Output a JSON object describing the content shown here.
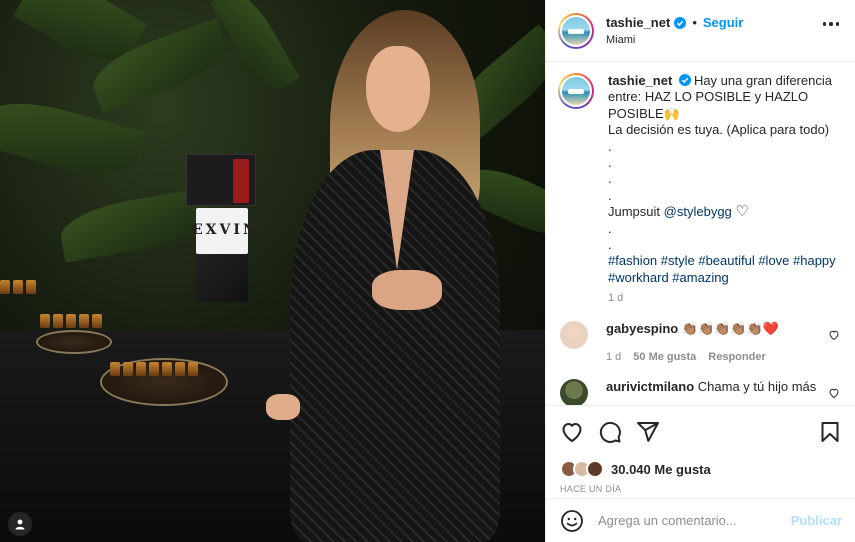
{
  "colors": {
    "accent": "#0095f6",
    "text": "#262626",
    "muted": "#8e8e8e",
    "like_red": "#ed4956",
    "link": "#00376b"
  },
  "photo": {
    "sign_text": "EXVIN"
  },
  "header": {
    "username": "tashie_net",
    "separator": "•",
    "follow_label": "Seguir",
    "location": "Miami",
    "more_icon": "more-horizontal-icon"
  },
  "caption": {
    "username": "tashie_net",
    "lines": [
      "Hay una gran diferencia entre: HAZ LO POSIBLE y HAZLO POSIBLE🙌",
      "La decisión es tuya. (Aplica para todo)",
      ".",
      ".",
      ".",
      ".",
      "Jumpsuit",
      ".",
      ".",
      "#fashion #style #beautiful #love #happy #workhard #amazing"
    ],
    "mention": "@stylebygg",
    "heart": "♡",
    "time": "1 d"
  },
  "comments": [
    {
      "username": "gabyespino",
      "text": "👏🏽👏🏽👏🏽👏🏽👏🏽❤️",
      "time": "1 d",
      "likes": "50 Me gusta",
      "reply": "Responder"
    },
    {
      "username": "aurivictmilano",
      "text": "Chama y tú hijo más",
      "time": "",
      "likes": "",
      "reply": ""
    }
  ],
  "actions": {
    "likes_count": "30.040",
    "likes_label": "Me gusta",
    "posted_ago": "HACE UN DÍA"
  },
  "add_comment": {
    "placeholder": "Agrega un comentario...",
    "publish_label": "Publicar"
  }
}
